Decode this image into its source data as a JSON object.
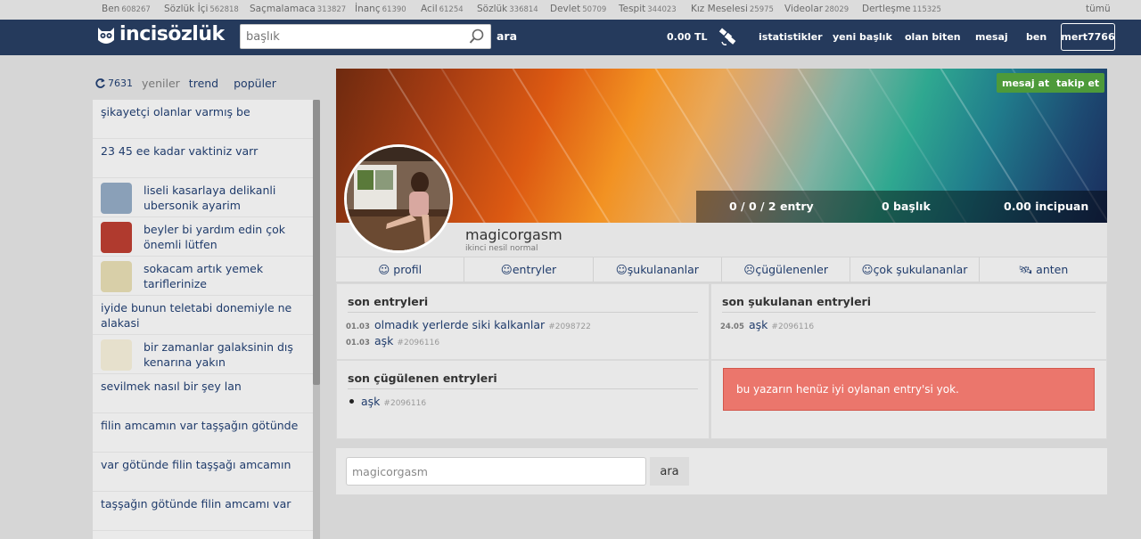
{
  "category_bar": {
    "items": [
      {
        "label": "Ben",
        "count": "608267"
      },
      {
        "label": "Sözlük İçi",
        "count": "562818"
      },
      {
        "label": "Saçmalamaca",
        "count": "313827"
      },
      {
        "label": "İnanç",
        "count": "61390"
      },
      {
        "label": "Acil",
        "count": "61254"
      },
      {
        "label": "Sözlük",
        "count": "336814"
      },
      {
        "label": "Devlet",
        "count": "50709"
      },
      {
        "label": "Tespit",
        "count": "344023"
      },
      {
        "label": "Kız Meselesi",
        "count": "25975"
      },
      {
        "label": "Videolar",
        "count": "28029"
      },
      {
        "label": "Dertleşme",
        "count": "115325"
      }
    ],
    "all_label": "tümü"
  },
  "header": {
    "logo": "incisözlük",
    "search_placeholder": "başlık",
    "search_button": "ara",
    "balance": "0.00 TL",
    "nav": [
      "istatistikler",
      "yeni başlık",
      "olan biten",
      "mesaj",
      "ben"
    ],
    "username": "mert7766"
  },
  "sidebar": {
    "refresh_count": "7631",
    "tabs": [
      "yeniler",
      "trend",
      "popüler"
    ],
    "items": [
      {
        "label": "şikayetçi olanlar varmış be",
        "thumb": false
      },
      {
        "label": "23 45 ee kadar vaktiniz varr",
        "thumb": false
      },
      {
        "label": "liseli kasarlaya delikanli ubersonik ayarim",
        "thumb": true,
        "thumb_color": "#8aa0b8"
      },
      {
        "label": "beyler bi yardım edin çok önemli lütfen",
        "thumb": true,
        "thumb_color": "#b03a2e"
      },
      {
        "label": "sokacam artık yemek tariflerinize",
        "thumb": true,
        "thumb_color": "#d8cfa8"
      },
      {
        "label": "iyide bunun teletabi donemiyle ne alakasi",
        "thumb": false
      },
      {
        "label": "bir zamanlar galaksinin dış kenarına yakın",
        "thumb": true,
        "thumb_color": "#e6e0cc"
      },
      {
        "label": "sevilmek nasıl bir şey lan",
        "thumb": false
      },
      {
        "label": "filin amcamın var taşşağın götünde",
        "thumb": false
      },
      {
        "label": "var götünde filin taşşağı amcamın",
        "thumb": false
      },
      {
        "label": "taşşağın götünde filin amcamı var",
        "thumb": false
      }
    ]
  },
  "profile": {
    "buttons": {
      "message": "mesaj at",
      "follow": "takip et"
    },
    "stats": {
      "entries": "0 / 0 / 2 entry",
      "topics": "0 başlık",
      "points": "0.00 incipuan"
    },
    "username": "magicorgasm",
    "rank": "ikinci nesil normal",
    "tabs": [
      "profil",
      "entryler",
      "şukulananlar",
      "çügülenenler",
      "çok şukulananlar",
      "anten"
    ]
  },
  "panels": {
    "recent_entries": {
      "title": "son entryleri",
      "rows": [
        {
          "date": "01.03",
          "title": "olmadık yerlerde siki kalkanlar",
          "id": "#2098722"
        },
        {
          "date": "01.03",
          "title": "aşk",
          "id": "#2096116"
        }
      ]
    },
    "recent_liked": {
      "title": "son şukulanan entryleri",
      "rows": [
        {
          "date": "24.05",
          "title": "aşk",
          "id": "#2096116"
        }
      ]
    },
    "recent_disliked": {
      "title": "son çügülenen entryleri",
      "rows": [
        {
          "title": "aşk",
          "id": "#2096116"
        }
      ]
    },
    "alert": "bu yazarın henüz iyi oylanan entry'si yok."
  },
  "bottom_search": {
    "value": "magicorgasm",
    "button": "ara"
  }
}
